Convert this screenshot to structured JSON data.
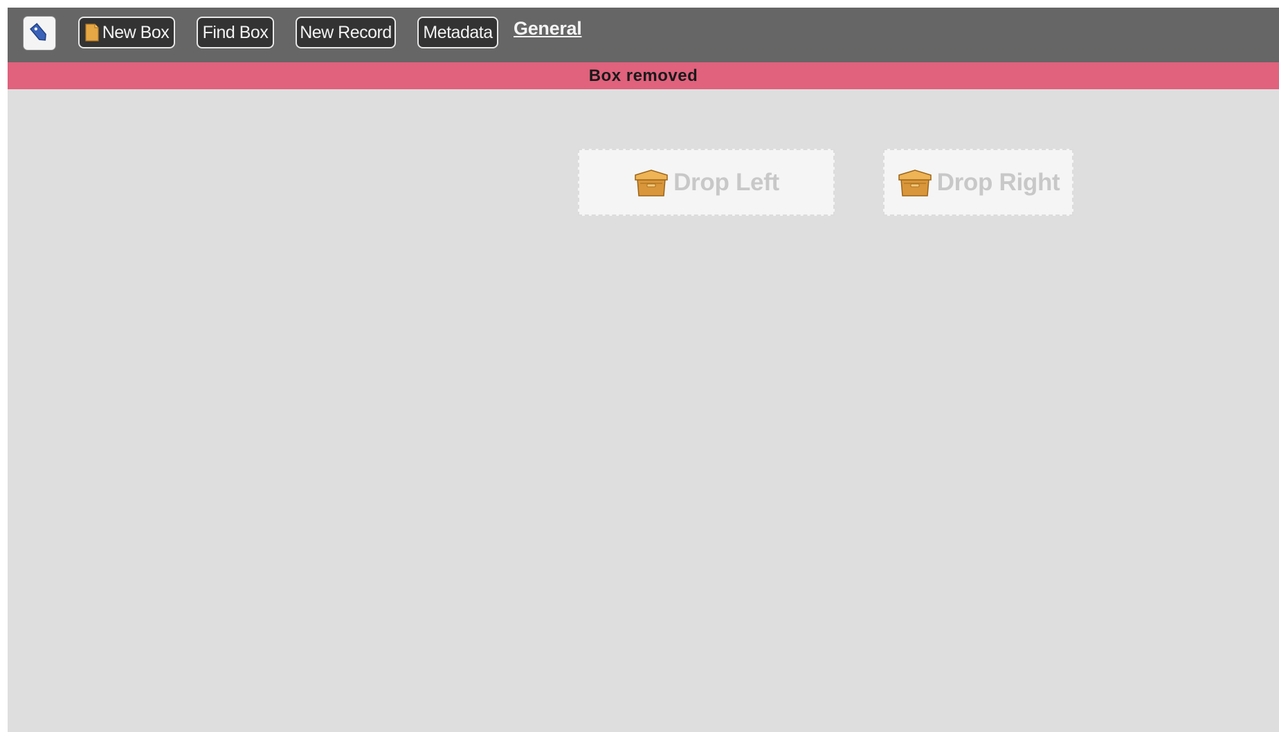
{
  "toolbar": {
    "home_icon": "tag-icon",
    "buttons": {
      "new_box": "New Box",
      "find_box": "Find Box",
      "new_record": "New Record",
      "metadata": "Metadata"
    },
    "link_general": "General"
  },
  "status": {
    "message": "Box removed",
    "color": "#e0627d"
  },
  "drop_zones": {
    "left": {
      "label": "Drop Left",
      "icon": "box-icon"
    },
    "right": {
      "label": "Drop Right",
      "icon": "box-icon"
    }
  },
  "colors": {
    "toolbar_bg": "#666666",
    "content_bg": "#dedede",
    "button_bg": "#333333"
  }
}
